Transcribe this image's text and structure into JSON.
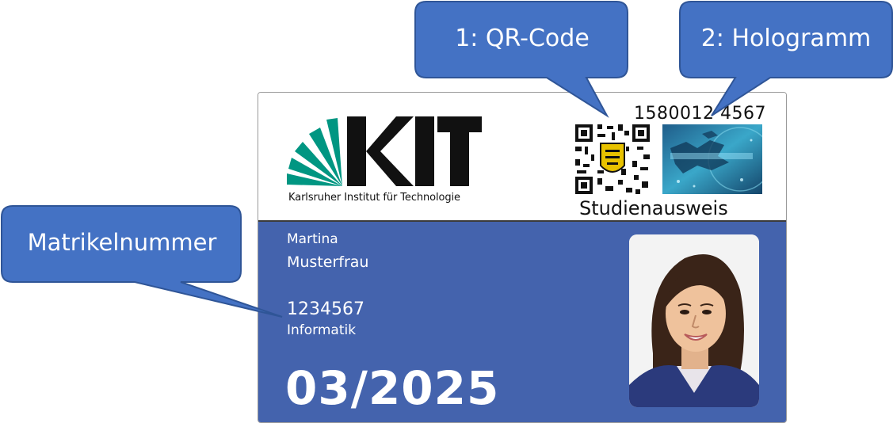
{
  "callouts": {
    "qr": "1: QR-Code",
    "hologram": "2: Hologramm",
    "matrikel": "Matrikelnummer"
  },
  "card": {
    "logo_text": "KIT",
    "institution": "Karlsruher Institut für Technologie",
    "card_number": "1580012 4567",
    "card_type": "Studienausweis",
    "first_name": "Martina",
    "last_name": "Musterfrau",
    "matrikelnummer": "1234567",
    "faculty": "Informatik",
    "valid_until": "03/2025"
  },
  "colors": {
    "callout_fill": "#4472c4",
    "callout_border": "#2f5597",
    "card_band": "#4463ad",
    "kit_green": "#009682"
  },
  "icons": {
    "qr": "qr-code-icon",
    "hologram": "hologram-icon",
    "photo": "student-photo"
  }
}
